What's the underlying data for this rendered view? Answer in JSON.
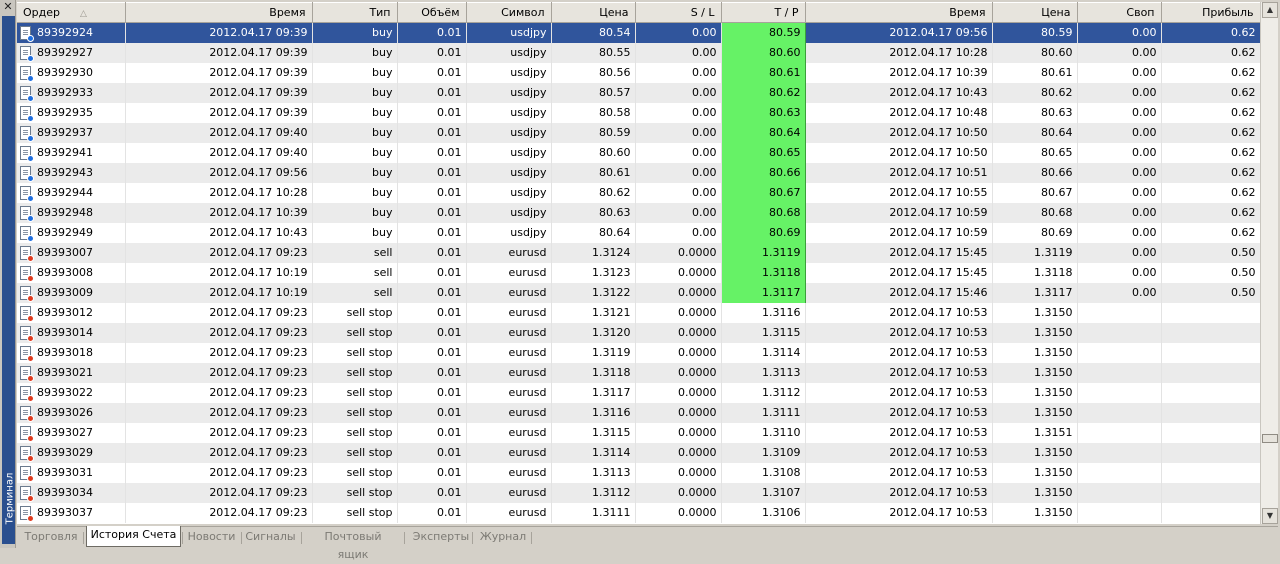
{
  "side": {
    "close": "✕",
    "title": "Терминал"
  },
  "columns": {
    "order": "Ордер",
    "open_time": "Время",
    "type": "Тип",
    "volume": "Объём",
    "symbol": "Символ",
    "open_price": "Цена",
    "sl": "S / L",
    "tp": "T / P",
    "close_time": "Время",
    "close_price": "Цена",
    "swap": "Своп",
    "profit": "Прибыль"
  },
  "rows": [
    {
      "order": "89392924",
      "open_time": "2012.04.17 09:39",
      "type": "buy",
      "volume": "0.01",
      "symbol": "usdjpy",
      "open_price": "80.54",
      "sl": "0.00",
      "tp": "80.59",
      "close_time": "2012.04.17 09:56",
      "close_price": "80.59",
      "swap": "0.00",
      "profit": "0.62"
    },
    {
      "order": "89392927",
      "open_time": "2012.04.17 09:39",
      "type": "buy",
      "volume": "0.01",
      "symbol": "usdjpy",
      "open_price": "80.55",
      "sl": "0.00",
      "tp": "80.60",
      "close_time": "2012.04.17 10:28",
      "close_price": "80.60",
      "swap": "0.00",
      "profit": "0.62"
    },
    {
      "order": "89392930",
      "open_time": "2012.04.17 09:39",
      "type": "buy",
      "volume": "0.01",
      "symbol": "usdjpy",
      "open_price": "80.56",
      "sl": "0.00",
      "tp": "80.61",
      "close_time": "2012.04.17 10:39",
      "close_price": "80.61",
      "swap": "0.00",
      "profit": "0.62"
    },
    {
      "order": "89392933",
      "open_time": "2012.04.17 09:39",
      "type": "buy",
      "volume": "0.01",
      "symbol": "usdjpy",
      "open_price": "80.57",
      "sl": "0.00",
      "tp": "80.62",
      "close_time": "2012.04.17 10:43",
      "close_price": "80.62",
      "swap": "0.00",
      "profit": "0.62"
    },
    {
      "order": "89392935",
      "open_time": "2012.04.17 09:39",
      "type": "buy",
      "volume": "0.01",
      "symbol": "usdjpy",
      "open_price": "80.58",
      "sl": "0.00",
      "tp": "80.63",
      "close_time": "2012.04.17 10:48",
      "close_price": "80.63",
      "swap": "0.00",
      "profit": "0.62"
    },
    {
      "order": "89392937",
      "open_time": "2012.04.17 09:40",
      "type": "buy",
      "volume": "0.01",
      "symbol": "usdjpy",
      "open_price": "80.59",
      "sl": "0.00",
      "tp": "80.64",
      "close_time": "2012.04.17 10:50",
      "close_price": "80.64",
      "swap": "0.00",
      "profit": "0.62"
    },
    {
      "order": "89392941",
      "open_time": "2012.04.17 09:40",
      "type": "buy",
      "volume": "0.01",
      "symbol": "usdjpy",
      "open_price": "80.60",
      "sl": "0.00",
      "tp": "80.65",
      "close_time": "2012.04.17 10:50",
      "close_price": "80.65",
      "swap": "0.00",
      "profit": "0.62"
    },
    {
      "order": "89392943",
      "open_time": "2012.04.17 09:56",
      "type": "buy",
      "volume": "0.01",
      "symbol": "usdjpy",
      "open_price": "80.61",
      "sl": "0.00",
      "tp": "80.66",
      "close_time": "2012.04.17 10:51",
      "close_price": "80.66",
      "swap": "0.00",
      "profit": "0.62"
    },
    {
      "order": "89392944",
      "open_time": "2012.04.17 10:28",
      "type": "buy",
      "volume": "0.01",
      "symbol": "usdjpy",
      "open_price": "80.62",
      "sl": "0.00",
      "tp": "80.67",
      "close_time": "2012.04.17 10:55",
      "close_price": "80.67",
      "swap": "0.00",
      "profit": "0.62"
    },
    {
      "order": "89392948",
      "open_time": "2012.04.17 10:39",
      "type": "buy",
      "volume": "0.01",
      "symbol": "usdjpy",
      "open_price": "80.63",
      "sl": "0.00",
      "tp": "80.68",
      "close_time": "2012.04.17 10:59",
      "close_price": "80.68",
      "swap": "0.00",
      "profit": "0.62"
    },
    {
      "order": "89392949",
      "open_time": "2012.04.17 10:43",
      "type": "buy",
      "volume": "0.01",
      "symbol": "usdjpy",
      "open_price": "80.64",
      "sl": "0.00",
      "tp": "80.69",
      "close_time": "2012.04.17 10:59",
      "close_price": "80.69",
      "swap": "0.00",
      "profit": "0.62"
    },
    {
      "order": "89393007",
      "open_time": "2012.04.17 09:23",
      "type": "sell",
      "volume": "0.01",
      "symbol": "eurusd",
      "open_price": "1.3124",
      "sl": "0.0000",
      "tp": "1.3119",
      "close_time": "2012.04.17 15:45",
      "close_price": "1.3119",
      "swap": "0.00",
      "profit": "0.50"
    },
    {
      "order": "89393008",
      "open_time": "2012.04.17 10:19",
      "type": "sell",
      "volume": "0.01",
      "symbol": "eurusd",
      "open_price": "1.3123",
      "sl": "0.0000",
      "tp": "1.3118",
      "close_time": "2012.04.17 15:45",
      "close_price": "1.3118",
      "swap": "0.00",
      "profit": "0.50"
    },
    {
      "order": "89393009",
      "open_time": "2012.04.17 10:19",
      "type": "sell",
      "volume": "0.01",
      "symbol": "eurusd",
      "open_price": "1.3122",
      "sl": "0.0000",
      "tp": "1.3117",
      "close_time": "2012.04.17 15:46",
      "close_price": "1.3117",
      "swap": "0.00",
      "profit": "0.50"
    },
    {
      "order": "89393012",
      "open_time": "2012.04.17 09:23",
      "type": "sell stop",
      "volume": "0.01",
      "symbol": "eurusd",
      "open_price": "1.3121",
      "sl": "0.0000",
      "tp": "1.3116",
      "close_time": "2012.04.17 10:53",
      "close_price": "1.3150",
      "swap": "",
      "profit": ""
    },
    {
      "order": "89393014",
      "open_time": "2012.04.17 09:23",
      "type": "sell stop",
      "volume": "0.01",
      "symbol": "eurusd",
      "open_price": "1.3120",
      "sl": "0.0000",
      "tp": "1.3115",
      "close_time": "2012.04.17 10:53",
      "close_price": "1.3150",
      "swap": "",
      "profit": ""
    },
    {
      "order": "89393018",
      "open_time": "2012.04.17 09:23",
      "type": "sell stop",
      "volume": "0.01",
      "symbol": "eurusd",
      "open_price": "1.3119",
      "sl": "0.0000",
      "tp": "1.3114",
      "close_time": "2012.04.17 10:53",
      "close_price": "1.3150",
      "swap": "",
      "profit": ""
    },
    {
      "order": "89393021",
      "open_time": "2012.04.17 09:23",
      "type": "sell stop",
      "volume": "0.01",
      "symbol": "eurusd",
      "open_price": "1.3118",
      "sl": "0.0000",
      "tp": "1.3113",
      "close_time": "2012.04.17 10:53",
      "close_price": "1.3150",
      "swap": "",
      "profit": ""
    },
    {
      "order": "89393022",
      "open_time": "2012.04.17 09:23",
      "type": "sell stop",
      "volume": "0.01",
      "symbol": "eurusd",
      "open_price": "1.3117",
      "sl": "0.0000",
      "tp": "1.3112",
      "close_time": "2012.04.17 10:53",
      "close_price": "1.3150",
      "swap": "",
      "profit": ""
    },
    {
      "order": "89393026",
      "open_time": "2012.04.17 09:23",
      "type": "sell stop",
      "volume": "0.01",
      "symbol": "eurusd",
      "open_price": "1.3116",
      "sl": "0.0000",
      "tp": "1.3111",
      "close_time": "2012.04.17 10:53",
      "close_price": "1.3150",
      "swap": "",
      "profit": ""
    },
    {
      "order": "89393027",
      "open_time": "2012.04.17 09:23",
      "type": "sell stop",
      "volume": "0.01",
      "symbol": "eurusd",
      "open_price": "1.3115",
      "sl": "0.0000",
      "tp": "1.3110",
      "close_time": "2012.04.17 10:53",
      "close_price": "1.3151",
      "swap": "",
      "profit": ""
    },
    {
      "order": "89393029",
      "open_time": "2012.04.17 09:23",
      "type": "sell stop",
      "volume": "0.01",
      "symbol": "eurusd",
      "open_price": "1.3114",
      "sl": "0.0000",
      "tp": "1.3109",
      "close_time": "2012.04.17 10:53",
      "close_price": "1.3150",
      "swap": "",
      "profit": ""
    },
    {
      "order": "89393031",
      "open_time": "2012.04.17 09:23",
      "type": "sell stop",
      "volume": "0.01",
      "symbol": "eurusd",
      "open_price": "1.3113",
      "sl": "0.0000",
      "tp": "1.3108",
      "close_time": "2012.04.17 10:53",
      "close_price": "1.3150",
      "swap": "",
      "profit": ""
    },
    {
      "order": "89393034",
      "open_time": "2012.04.17 09:23",
      "type": "sell stop",
      "volume": "0.01",
      "symbol": "eurusd",
      "open_price": "1.3112",
      "sl": "0.0000",
      "tp": "1.3107",
      "close_time": "2012.04.17 10:53",
      "close_price": "1.3150",
      "swap": "",
      "profit": ""
    },
    {
      "order": "89393037",
      "open_time": "2012.04.17 09:23",
      "type": "sell stop",
      "volume": "0.01",
      "symbol": "eurusd",
      "open_price": "1.3111",
      "sl": "0.0000",
      "tp": "1.3106",
      "close_time": "2012.04.17 10:53",
      "close_price": "1.3150",
      "swap": "",
      "profit": ""
    }
  ],
  "tabs": [
    {
      "label": "Торговля"
    },
    {
      "label": "История Счета"
    },
    {
      "label": "Новости"
    },
    {
      "label": "Сигналы"
    },
    {
      "label": "Почтовый ящик"
    },
    {
      "label": "Эксперты"
    },
    {
      "label": "Журнал"
    }
  ],
  "colors": {
    "selected_row": "#30559c",
    "tp_hit": "#66f266",
    "buy_icon": "#1e6ee0",
    "sell_icon": "#e03a1e"
  }
}
